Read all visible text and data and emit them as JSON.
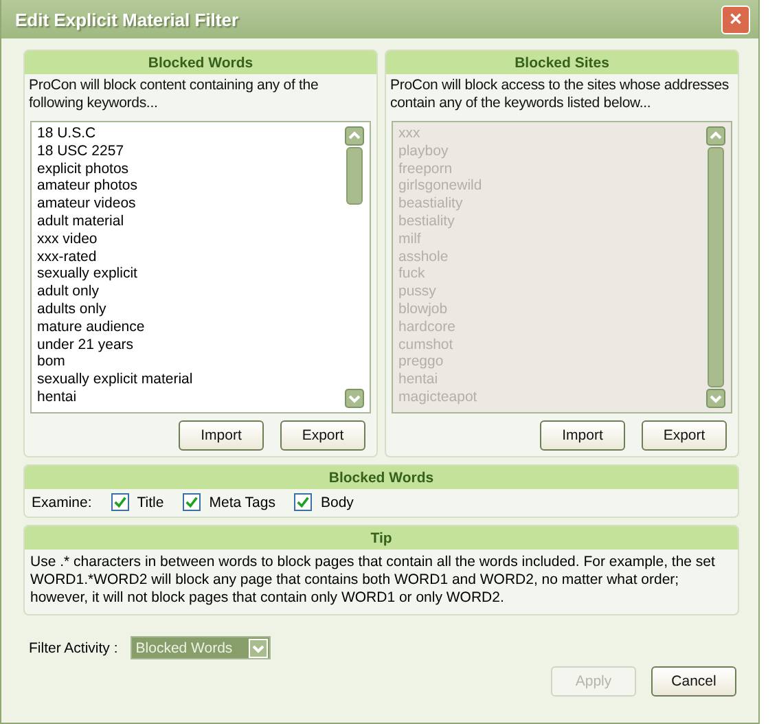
{
  "window": {
    "title": "Edit Explicit Material Filter",
    "close": "✕"
  },
  "lists": [
    {
      "heading": "Blocked Words",
      "description": "ProCon will block content containing any of the following keywords...",
      "disabled": false,
      "items": [
        "18 U.S.C",
        "18 USC 2257",
        "explicit photos",
        "amateur photos",
        "amateur videos",
        "adult material",
        "xxx video",
        "xxx-rated",
        "sexually explicit",
        "adult only",
        "adults only",
        "mature audience",
        "under 21 years",
        "bom",
        "sexually explicit material",
        "hentai"
      ],
      "buttons": [
        {
          "label": "Import",
          "disabled": false
        },
        {
          "label": "Export",
          "disabled": false
        }
      ]
    },
    {
      "heading": "Blocked Sites",
      "description": "ProCon will block access to the sites whose addresses contain any of the keywords listed below...",
      "disabled": true,
      "items": [
        "xxx",
        "playboy",
        "freeporn",
        "girlsgonewild",
        "beastiality",
        "bestiality",
        "milf",
        "asshole",
        "fuck",
        "pussy",
        "blowjob",
        "hardcore",
        "cumshot",
        "preggo",
        "hentai",
        "magicteapot"
      ],
      "buttons": [
        {
          "label": "Import",
          "disabled": false
        },
        {
          "label": "Export",
          "disabled": false
        }
      ]
    }
  ],
  "examine": {
    "heading": "Blocked Words",
    "label": "Examine:",
    "options": [
      {
        "label": "Title",
        "checked": true
      },
      {
        "label": "Meta Tags",
        "checked": true
      },
      {
        "label": "Body",
        "checked": true
      }
    ]
  },
  "tip": {
    "heading": "Tip",
    "text": "Use .* characters in between words to block pages that contain all the words included. For example, the set WORD1.*WORD2 will block any page that contains both WORD1 and WORD2, no matter what order; however, it will not block pages that contain only WORD1 or only WORD2."
  },
  "filter_activity": {
    "label": "Filter Activity :",
    "value": "Blocked Words"
  },
  "buttons": [
    {
      "label": "Apply",
      "disabled": true
    },
    {
      "label": "Cancel",
      "disabled": false
    }
  ]
}
